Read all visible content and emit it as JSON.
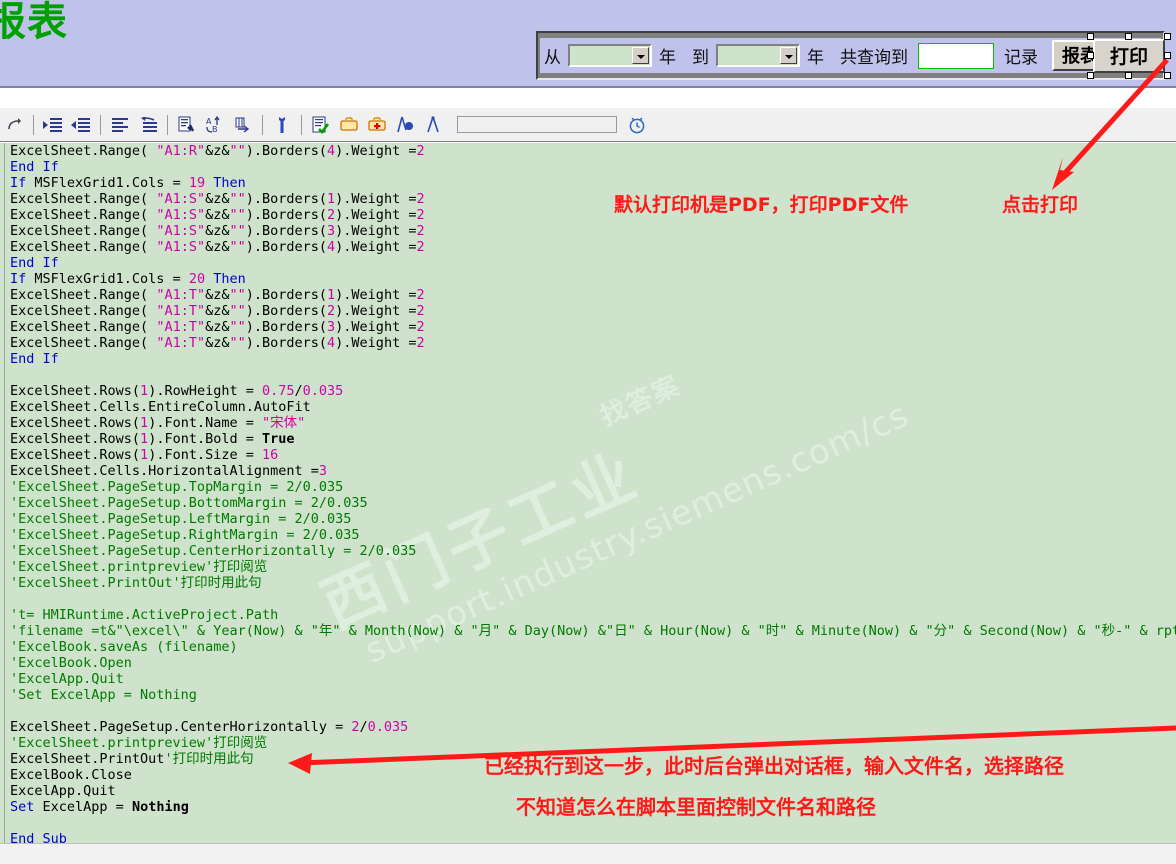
{
  "banner": {
    "title": "报表"
  },
  "query_toolbar": {
    "from_label": "从",
    "year_label_1": "年",
    "to_label": "到",
    "year_label_2": "年",
    "total_label": "共查询到",
    "record_label": "记录",
    "from_year_value": "",
    "to_year_value": "",
    "count_value": "",
    "export_button": "报表导出",
    "print_button": "打印"
  },
  "toolbar": {
    "icons": [
      {
        "name": "redo-icon",
        "label": "Redo"
      },
      {
        "name": "indent-increase-icon",
        "label": "Indent"
      },
      {
        "name": "indent-decrease-icon",
        "label": "Outdent"
      },
      {
        "name": "align-lines-icon",
        "label": "Align"
      },
      {
        "name": "undo-wrap-icon",
        "label": "Unwrap"
      },
      {
        "name": "find-in-file-icon",
        "label": "Find"
      },
      {
        "name": "sort-az-icon",
        "label": "Sort"
      },
      {
        "name": "find-next-icon",
        "label": "Find Next"
      },
      {
        "name": "wrench-icon",
        "label": "Tools"
      },
      {
        "name": "check-syntax-icon",
        "label": "Check syntax"
      },
      {
        "name": "briefcase-icon",
        "label": "Library"
      },
      {
        "name": "briefcase-add-icon",
        "label": "Add to library"
      },
      {
        "name": "compass-object-icon",
        "label": "Object"
      },
      {
        "name": "compass-icon",
        "label": "Measure"
      }
    ],
    "search_placeholder": "",
    "search_value": "",
    "clock_icon": "alarm-clock-icon"
  },
  "watermark": {
    "cn": "西门子工业",
    "cn_small": "找答案",
    "url": "support.industry.siemens.com/cs"
  },
  "annotations": {
    "printer_note": "默认打印机是PDF，打印PDF文件",
    "click_print": "点击打印",
    "step_note": "已经执行到这一步，此时后台弹出对话框，输入文件名，选择路径",
    "unknown_note": "不知道怎么在脚本里面控制文件名和路径"
  },
  "colors": {
    "banner_bg": "#bfc3ec",
    "title_green": "#00a000",
    "editor_bg": "#cfe3cc",
    "keyword_blue": "#0000d0",
    "string_magenta": "#d000a8",
    "comment_green": "#007a00",
    "annotation_red": "#ff1a1a"
  },
  "code": {
    "language": "VBScript",
    "lines": [
      "ExcelSheet.Range( \"A1:R\"&z&\"\").Borders(4).Weight =2",
      "End If",
      "If MSFlexGrid1.Cols = 19 Then",
      "ExcelSheet.Range( \"A1:S\"&z&\"\").Borders(1).Weight =2",
      "ExcelSheet.Range( \"A1:S\"&z&\"\").Borders(2).Weight =2",
      "ExcelSheet.Range( \"A1:S\"&z&\"\").Borders(3).Weight =2",
      "ExcelSheet.Range( \"A1:S\"&z&\"\").Borders(4).Weight =2",
      "End If",
      "If MSFlexGrid1.Cols = 20 Then",
      "ExcelSheet.Range( \"A1:T\"&z&\"\").Borders(1).Weight =2",
      "ExcelSheet.Range( \"A1:T\"&z&\"\").Borders(2).Weight =2",
      "ExcelSheet.Range( \"A1:T\"&z&\"\").Borders(3).Weight =2",
      "ExcelSheet.Range( \"A1:T\"&z&\"\").Borders(4).Weight =2",
      "End If",
      "",
      "ExcelSheet.Rows(1).RowHeight = 0.75/0.035",
      "ExcelSheet.Cells.EntireColumn.AutoFit",
      "ExcelSheet.Rows(1).Font.Name = \"宋体\"",
      "ExcelSheet.Rows(1).Font.Bold = True",
      "ExcelSheet.Rows(1).Font.Size = 16",
      "ExcelSheet.Cells.HorizontalAlignment =3",
      "'ExcelSheet.PageSetup.TopMargin = 2/0.035",
      "'ExcelSheet.PageSetup.BottomMargin = 2/0.035",
      "'ExcelSheet.PageSetup.LeftMargin = 2/0.035",
      "'ExcelSheet.PageSetup.RightMargin = 2/0.035",
      "'ExcelSheet.PageSetup.CenterHorizontally = 2/0.035",
      "'ExcelSheet.printpreview'打印阅览",
      "'ExcelSheet.PrintOut'打印时用此句",
      "",
      "'t= HMIRuntime.ActiveProject.Path",
      "'filename =t&\"\\excel\\\" & Year(Now) & \"年\" & Month(Now) & \"月\" & Day(Now) &\"日\" & Hour(Now) & \"时\" & Minute(Now) & \"分\" & Second(Now) & \"秒-\" & rpt",
      "'ExcelBook.saveAs (filename)",
      "'ExcelBook.Open",
      "'ExcelApp.Quit",
      "'Set ExcelApp = Nothing",
      "",
      "ExcelSheet.PageSetup.CenterHorizontally = 2/0.035",
      "'ExcelSheet.printpreview'打印阅览",
      "ExcelSheet.PrintOut'打印时用此句",
      "ExcelBook.Close",
      "ExcelApp.Quit",
      "Set ExcelApp = Nothing",
      "",
      "End Sub"
    ]
  }
}
